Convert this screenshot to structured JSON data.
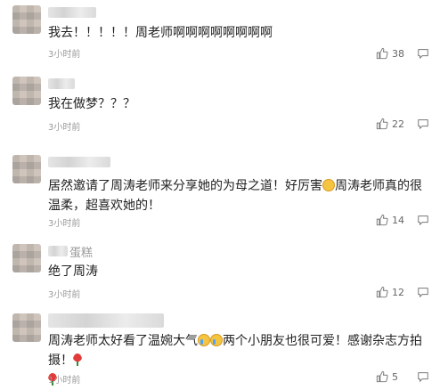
{
  "comments": [
    {
      "name": "",
      "text": "我去！！！！！周老师啊啊啊啊啊啊啊啊",
      "time": "3小时前",
      "likes": "38"
    },
    {
      "name": "",
      "text": "我在做梦？？？",
      "time": "3小时前",
      "likes": "22"
    },
    {
      "name": "",
      "text_a": "居然邀请了周涛老师来分享她的为母之道！好厉害",
      "text_b": "周涛老师真的很温柔，超喜欢她的！",
      "time": "3小时前",
      "likes": "14"
    },
    {
      "name": "蛋糕",
      "text": "绝了周涛",
      "time": "3小时前",
      "likes": "12"
    },
    {
      "name": "",
      "text_a": "周涛老师太好看了温婉大气",
      "text_b": "两个小朋友也很可爱！感谢杂志方拍摄！",
      "time": "1小时前",
      "likes": "5"
    }
  ],
  "icons": {
    "like": "thumbs-up-icon",
    "more": "chat-bubble-icon"
  }
}
